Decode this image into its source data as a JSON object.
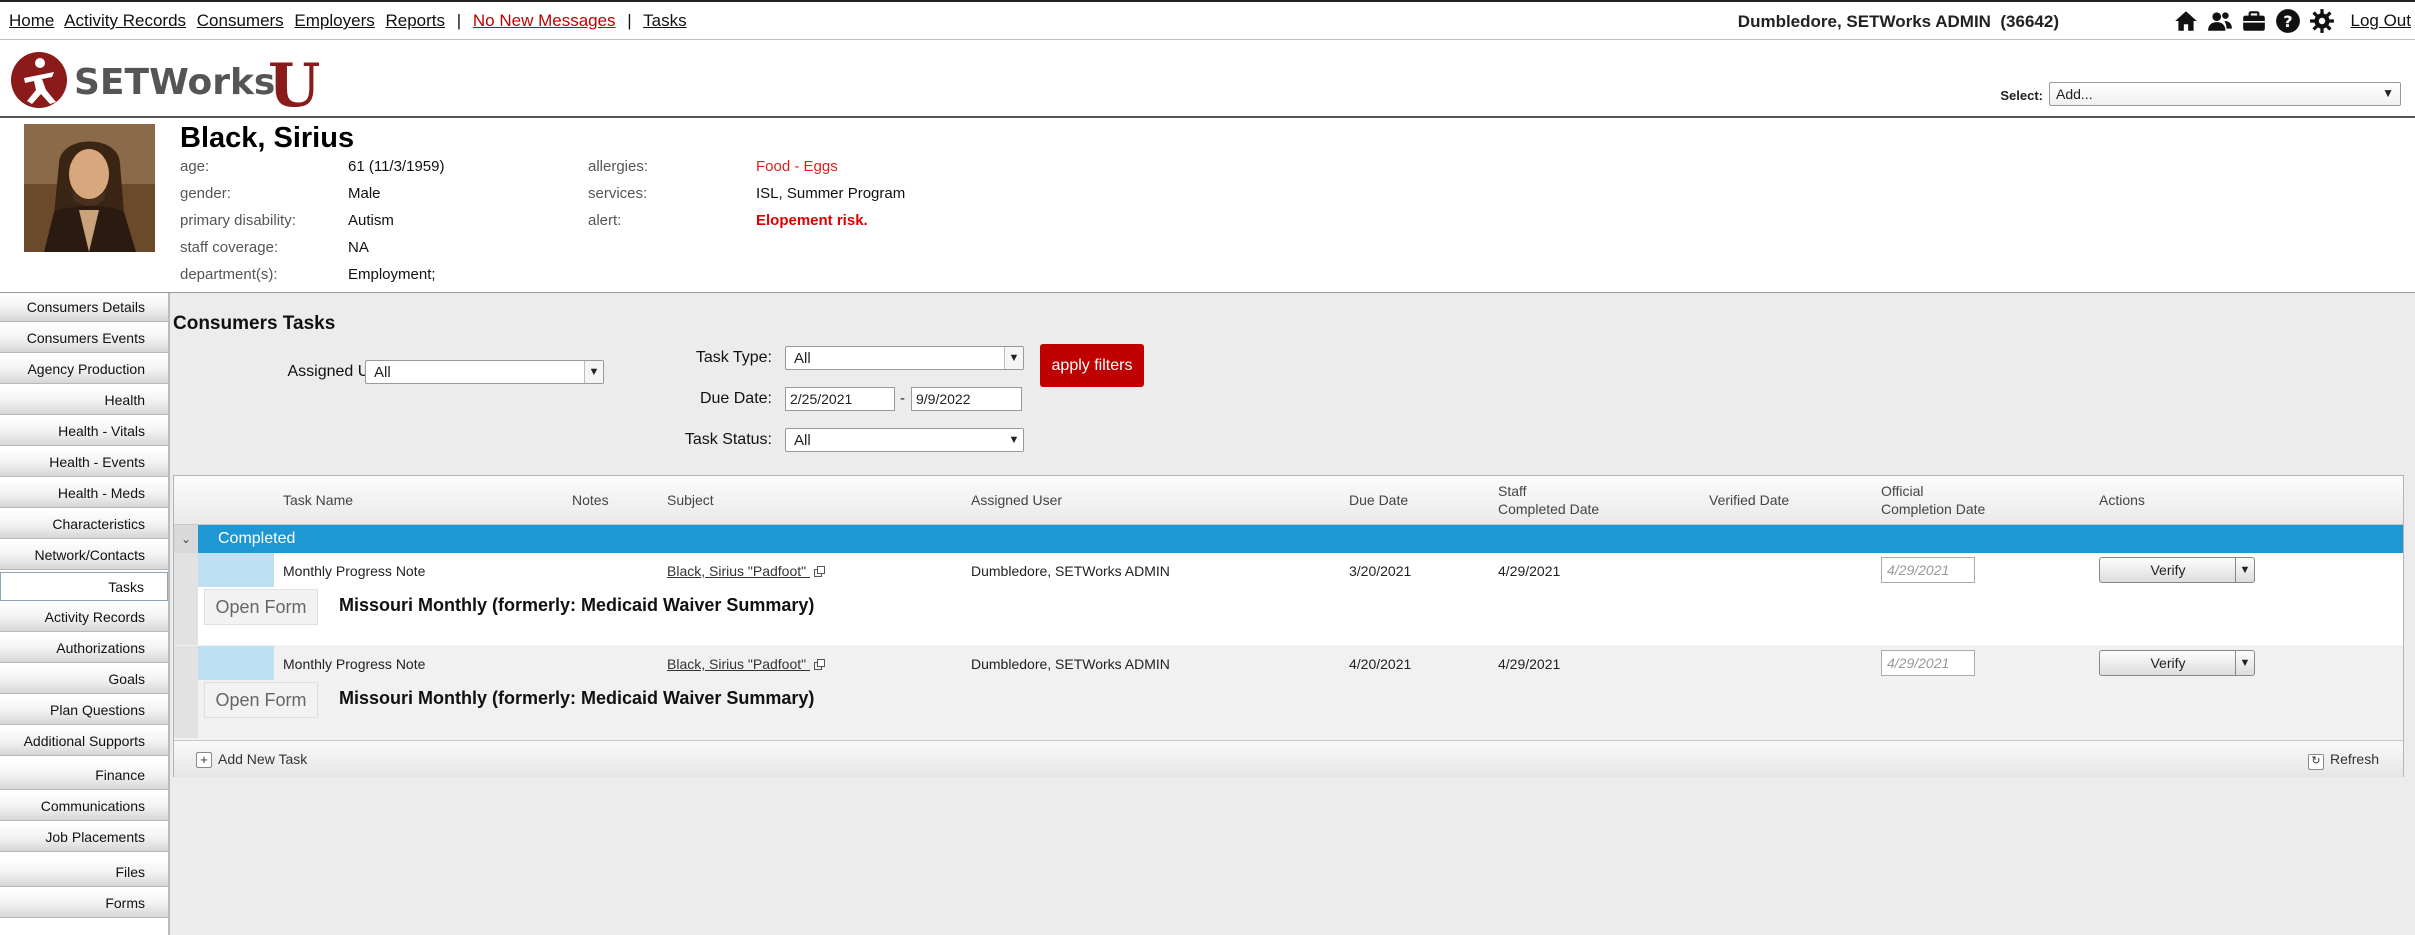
{
  "topnav": {
    "links": [
      "Home",
      "Activity Records",
      "Consumers",
      "Employers",
      "Reports"
    ],
    "separator": "|",
    "messages": "No New Messages",
    "tasks": "Tasks"
  },
  "user": {
    "name": "Dumbledore, SETWorks ADMIN",
    "id": "(36642)",
    "logout": "Log Out"
  },
  "top_icons": [
    "home-icon",
    "users-icon",
    "briefcase-icon",
    "help-icon",
    "gear-icon"
  ],
  "logo": {
    "text": "SETWorks",
    "letter": "U",
    "brand_color": "#8b1a1a"
  },
  "header_select": {
    "label": "Select:",
    "value": "Add..."
  },
  "consumer": {
    "name": "Black, Sirius",
    "fields": [
      {
        "label": "age:",
        "value": "61 (11/3/1959)"
      },
      {
        "label": "gender:",
        "value": "Male"
      },
      {
        "label": "primary disability:",
        "value": "Autism"
      },
      {
        "label": "staff coverage:",
        "value": "NA"
      },
      {
        "label": "department(s):",
        "value": "Employment;"
      }
    ],
    "fields2": [
      {
        "label": "allergies:",
        "value": "Food - Eggs"
      },
      {
        "label": "services:",
        "value": "ISL, Summer Program"
      },
      {
        "label": "alert:",
        "value": "Elopement risk."
      }
    ]
  },
  "sidebar": {
    "items": [
      "Consumers Details",
      "Consumers Events",
      "Agency Production",
      "Health",
      "Health - Vitals",
      "Health - Events",
      "Health - Meds",
      "Characteristics",
      "Network/Contacts",
      "Tasks",
      "Activity Records",
      "Authorizations",
      "Goals",
      "Plan Questions",
      "Additional Supports",
      "Finance",
      "Communications",
      "Job Placements",
      "Files",
      "Forms"
    ],
    "active": "Tasks"
  },
  "page": {
    "title": "Consumers Tasks"
  },
  "filters": {
    "assigned_user_label": "Assigned User:",
    "assigned_user": "All",
    "task_type_label": "Task Type:",
    "task_type": "All",
    "due_date_label": "Due Date:",
    "due_from": "2/25/2021",
    "due_dash": "-",
    "due_to": "9/9/2022",
    "task_status_label": "Task Status:",
    "task_status": "All",
    "apply": "apply filters"
  },
  "grid": {
    "headers": {
      "task_name": "Task Name",
      "notes": "Notes",
      "subject": "Subject",
      "assigned_user": "Assigned User",
      "due_date": "Due Date",
      "staff_completed_1": "Staff",
      "staff_completed_2": "Completed Date",
      "verified_date": "Verified Date",
      "official_1": "Official",
      "official_2": "Completion Date",
      "actions": "Actions"
    },
    "group": {
      "toggle": "⌄",
      "label": "Completed"
    },
    "rows": [
      {
        "task_name": "Monthly Progress Note",
        "subject": "Black, Sirius \"Padfoot\"",
        "assigned_user": "Dumbledore, SETWorks ADMIN",
        "due_date": "3/20/2021",
        "staff_completed": "4/29/2021",
        "official_completion": "4/29/2021",
        "action": "Verify",
        "open_form": "Open Form",
        "form_title": "Missouri Monthly (formerly: Medicaid Waiver Summary)"
      },
      {
        "task_name": "Monthly Progress Note",
        "subject": "Black, Sirius \"Padfoot\"",
        "assigned_user": "Dumbledore, SETWorks ADMIN",
        "due_date": "4/20/2021",
        "staff_completed": "4/29/2021",
        "official_completion": "4/29/2021",
        "action": "Verify",
        "open_form": "Open Form",
        "form_title": "Missouri Monthly (formerly: Medicaid Waiver Summary)"
      }
    ],
    "footer": {
      "add": "Add New Task",
      "refresh": "Refresh"
    }
  },
  "colors": {
    "accent_red": "#c00000",
    "group_blue": "#1f97d3"
  }
}
